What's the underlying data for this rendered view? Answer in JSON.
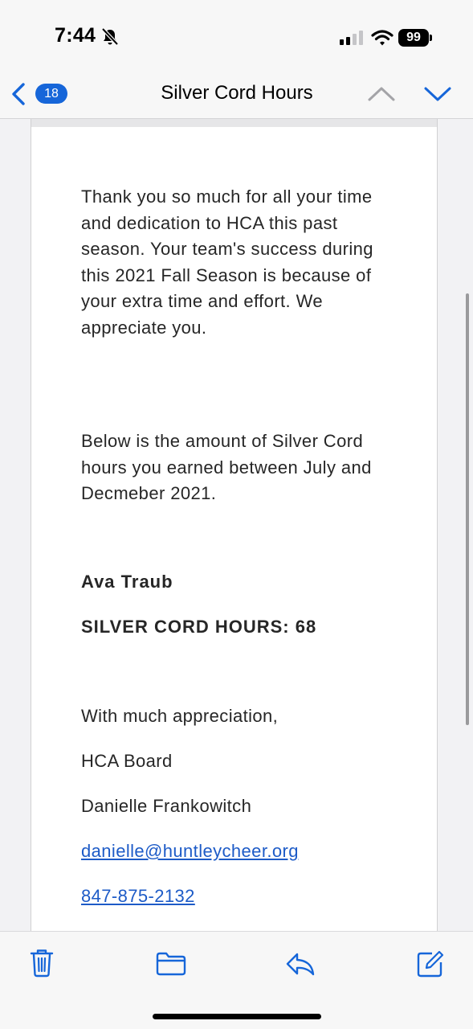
{
  "status_bar": {
    "time": "7:44",
    "battery": "99",
    "icons": [
      "bell-slash-icon",
      "cellular-signal-icon",
      "wifi-icon",
      "battery-icon"
    ]
  },
  "nav": {
    "unread_count": "18",
    "title": "Silver Cord Hours",
    "icons": [
      "back-chevron-icon",
      "up-chevron-icon",
      "down-chevron-icon"
    ]
  },
  "email": {
    "paragraph_1": "Thank you so much for all your time and dedication to HCA this past season. Your team's success during this 2021 Fall Season is because of your extra time and effort. We appreciate you.",
    "paragraph_2": "Below is the amount of Silver Cord hours you earned between July and Decmeber 2021.",
    "name": "Ava Traub",
    "hours_line": "SILVER CORD HOURS: 68",
    "closing": "With much appreciation,",
    "signature_org": "HCA Board",
    "signature_name": "Danielle Frankowitch",
    "email_link": "danielle@huntleycheer.org",
    "phone_link": "847-875-2132"
  },
  "toolbar": {
    "icons": [
      "trash-icon",
      "folder-icon",
      "reply-icon",
      "compose-icon"
    ]
  },
  "colors": {
    "accent": "#1666d9",
    "link": "#1d5bc7",
    "text": "#262626"
  }
}
